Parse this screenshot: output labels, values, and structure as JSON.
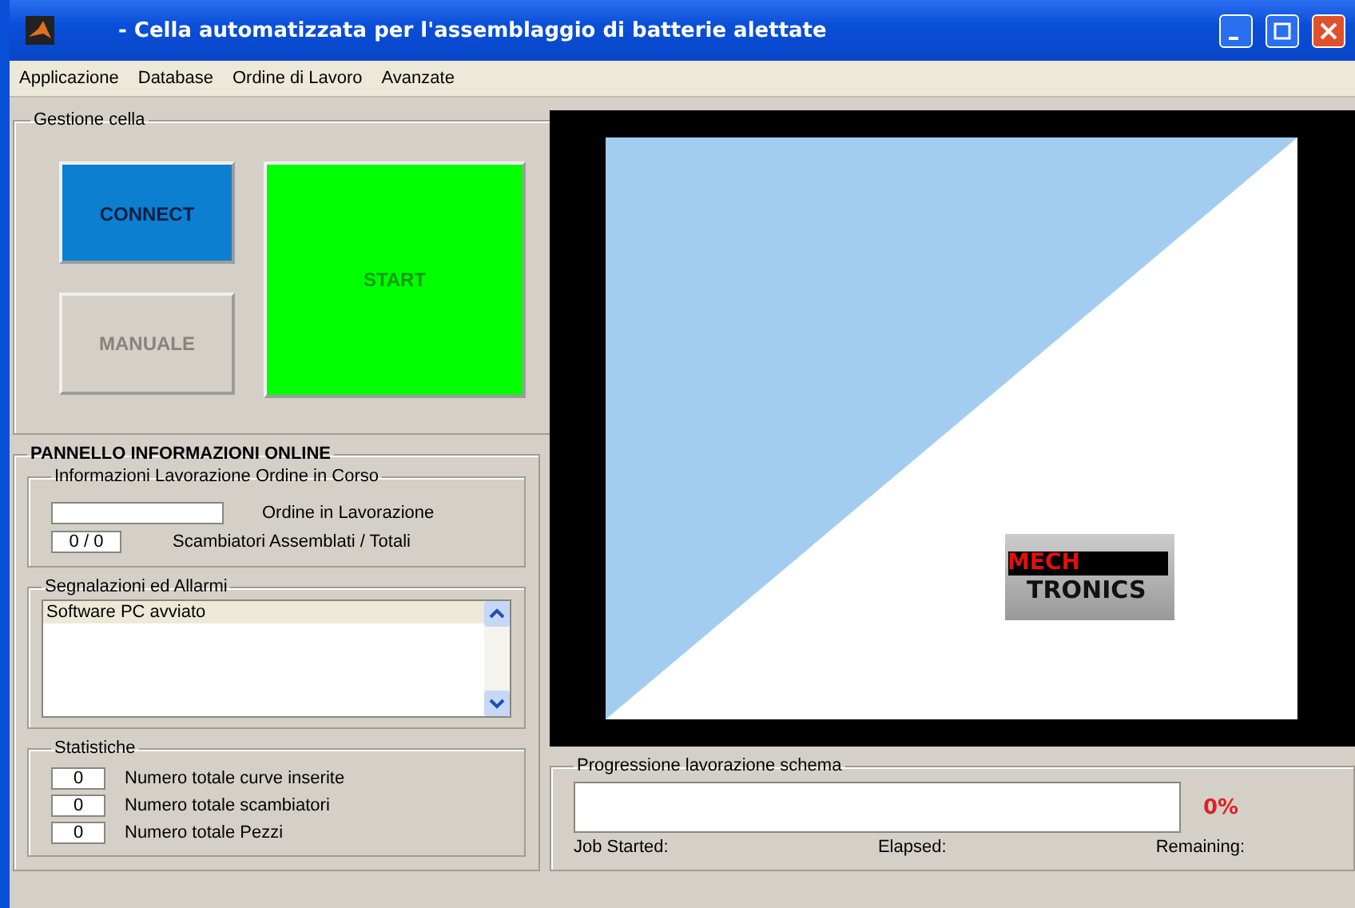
{
  "window": {
    "title": "- Cella automatizzata per l'assemblaggio di batterie alettate"
  },
  "menu": [
    "Applicazione",
    "Database",
    "Ordine di Lavoro",
    "Avanzate"
  ],
  "gestione": {
    "title": "Gestione cella",
    "buttons": [
      {
        "label": "CONNECT",
        "kind": "connect",
        "disabled": false
      },
      {
        "label": "MANUALE",
        "kind": "manual",
        "disabled": true
      },
      {
        "label": "START",
        "kind": "start",
        "disabled": true
      }
    ]
  },
  "pannello": {
    "title": "PANNELLO INFORMAZIONI ONLINE",
    "ordine": {
      "title": "Informazioni Lavorazione Ordine in Corso",
      "fields": [
        {
          "label": "Ordine in Lavorazione"
        },
        {
          "value": "0 / 0",
          "label": "Scambiatori Assemblati / Totali"
        }
      ]
    },
    "allarmi": {
      "title": "Segnalazioni ed Allarmi",
      "items": [
        "Software PC avviato"
      ]
    },
    "statistiche": {
      "title": "Statistiche",
      "fields": [
        {
          "value": "0",
          "label": "Numero totale curve inserite"
        },
        {
          "value": "0",
          "label": "Numero totale scambiatori"
        },
        {
          "value": "0",
          "label": "Numero totale Pezzi"
        }
      ]
    }
  },
  "logo": {
    "line_1": "MECH",
    "line_2": "TRONICS"
  },
  "progress": {
    "title": "Progressione lavorazione schema",
    "level": 0,
    "percent": "0%",
    "labels": [
      "Job Started:",
      "Elapsed:",
      "Remaining:"
    ]
  }
}
